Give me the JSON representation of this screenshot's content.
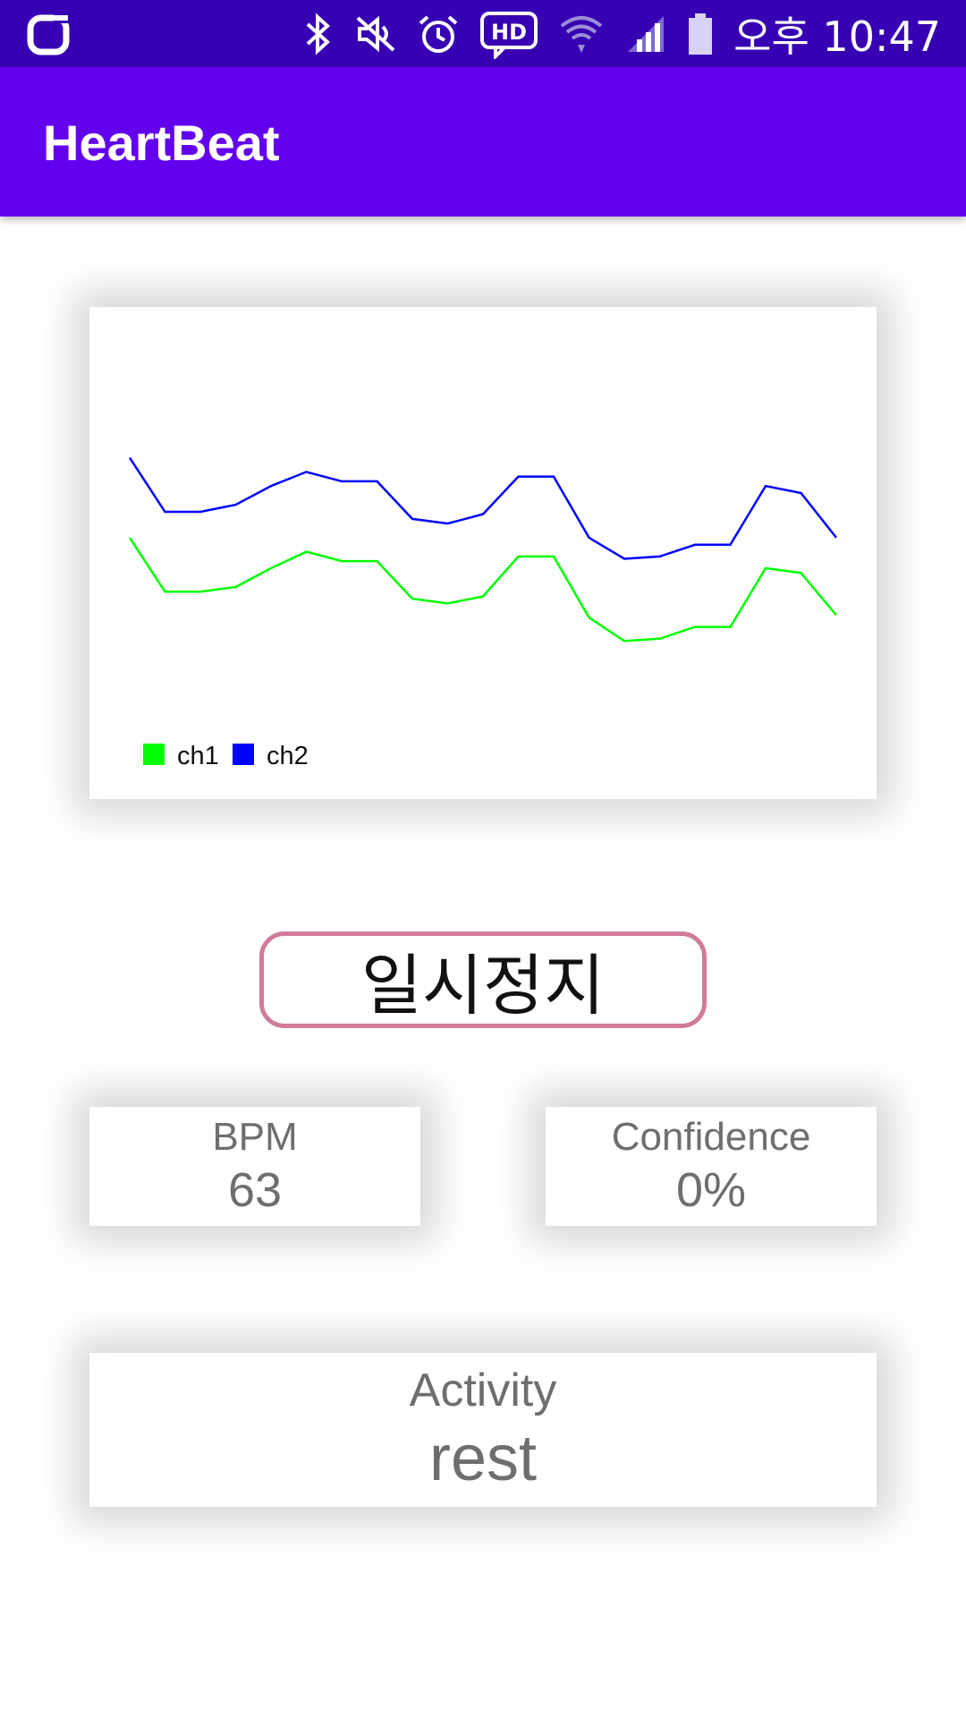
{
  "status_bar": {
    "time": "오후 10:47",
    "icons": [
      "app-logo-icon",
      "bluetooth-icon",
      "mute-icon",
      "alarm-icon",
      "hd-icon",
      "wifi-icon",
      "signal-icon",
      "battery-icon"
    ]
  },
  "app_bar": {
    "title": "HeartBeat"
  },
  "chart_data": {
    "type": "line",
    "title": "",
    "xlabel": "",
    "ylabel": "",
    "grid": false,
    "axes_visible": false,
    "legend_position": "bottom-left",
    "x": [
      0,
      1,
      2,
      3,
      4,
      5,
      6,
      7,
      8,
      9,
      10,
      11,
      12,
      13,
      14,
      15,
      16,
      17,
      18,
      19,
      20
    ],
    "ylim": [
      0,
      16
    ],
    "series": [
      {
        "name": "ch1",
        "color": "#00ff00",
        "values": [
          7.7,
          5.4,
          5.4,
          5.6,
          6.4,
          7.1,
          6.7,
          6.7,
          5.1,
          4.9,
          5.2,
          6.9,
          6.9,
          4.3,
          3.3,
          3.4,
          3.9,
          3.9,
          6.4,
          6.2,
          4.4
        ]
      },
      {
        "name": "ch2",
        "color": "#0000ff",
        "values": [
          11.1,
          8.8,
          8.8,
          9.1,
          9.9,
          10.5,
          10.1,
          10.1,
          8.5,
          8.3,
          8.7,
          10.3,
          10.3,
          7.7,
          6.8,
          6.9,
          7.4,
          7.4,
          9.9,
          9.6,
          7.7
        ]
      }
    ]
  },
  "pause_button": {
    "label": "일시정지"
  },
  "bpm": {
    "label": "BPM",
    "value": "63"
  },
  "confidence": {
    "label": "Confidence",
    "value": "0%"
  },
  "activity": {
    "label": "Activity",
    "value": "rest"
  },
  "colors": {
    "status_bar": "#3700b3",
    "app_bar": "#6200ee",
    "button_border": "#d17a9c",
    "stat_text": "#6e6e6e"
  }
}
